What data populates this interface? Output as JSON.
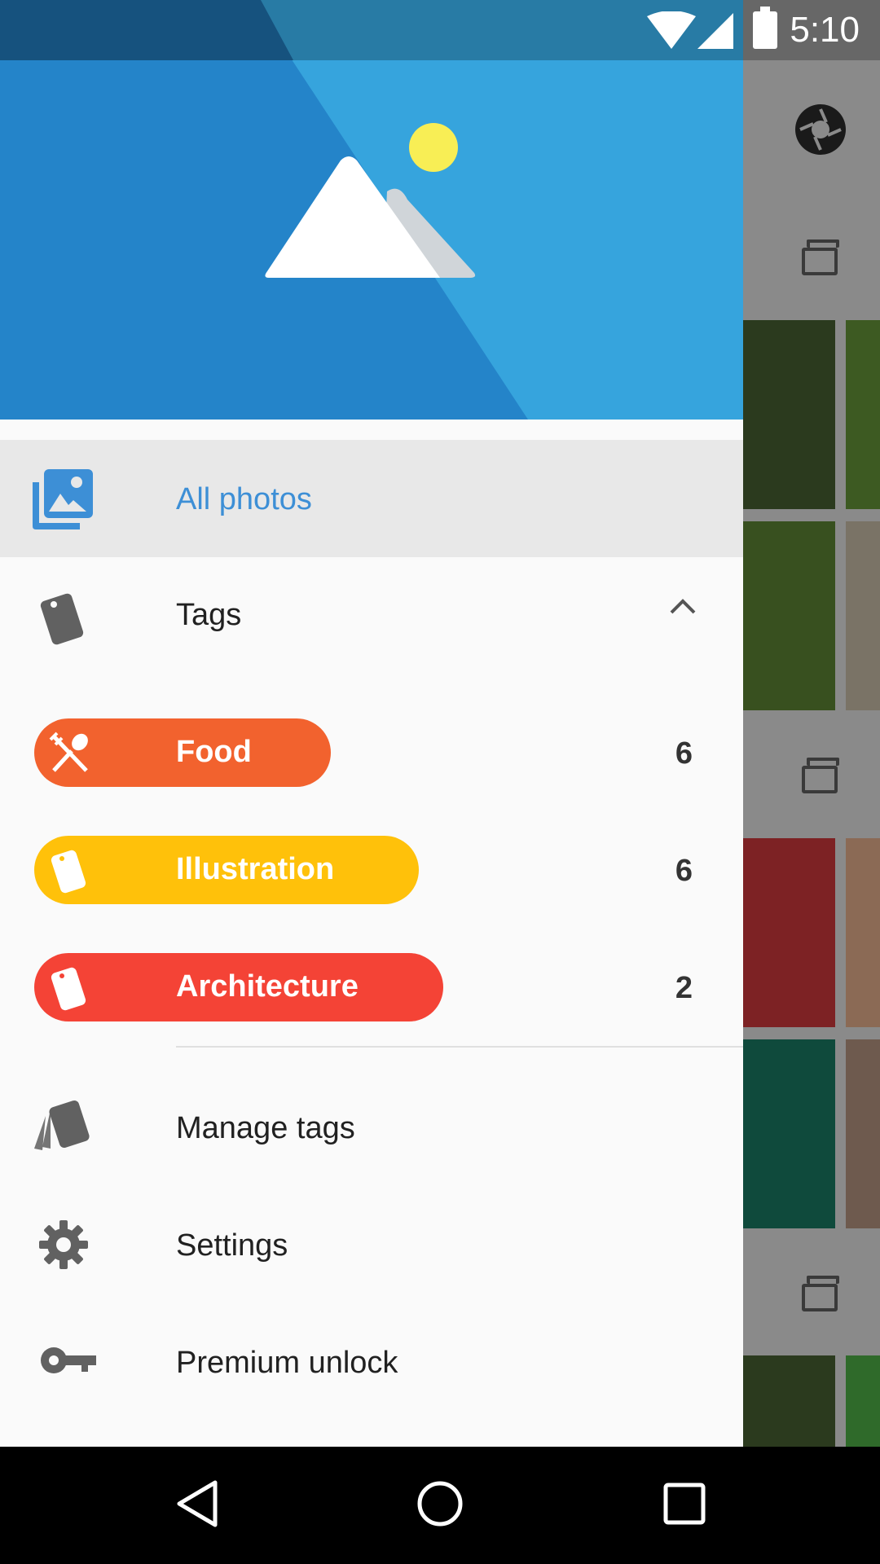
{
  "status_bar": {
    "time": "5:10"
  },
  "drawer": {
    "header": {
      "logo": "mountain-landscape-logo"
    },
    "all_photos": {
      "label": "All photos",
      "icon": "photo-library-icon"
    },
    "tags_section": {
      "label": "Tags",
      "expanded": true,
      "icon": "tag-icon"
    },
    "tags": [
      {
        "label": "Food",
        "count": "6",
        "color": "#f2622e",
        "icon": "fork-spoon-icon"
      },
      {
        "label": "Illustration",
        "count": "6",
        "color": "#ffc10a",
        "icon": "tag-icon"
      },
      {
        "label": "Architecture",
        "count": "2",
        "color": "#f44336",
        "icon": "tag-icon"
      }
    ],
    "menu": [
      {
        "label": "Manage tags",
        "icon": "multiple-tags-icon"
      },
      {
        "label": "Settings",
        "icon": "gear-icon"
      },
      {
        "label": "Premium unlock",
        "icon": "key-icon"
      }
    ]
  },
  "colors": {
    "accent": "#3d8fd6",
    "header_dark": "#2b8ad0",
    "header_light": "#36a4dd",
    "sun": "#f8ee55"
  },
  "nav_bar": {
    "buttons": [
      "back",
      "home",
      "recents"
    ]
  }
}
